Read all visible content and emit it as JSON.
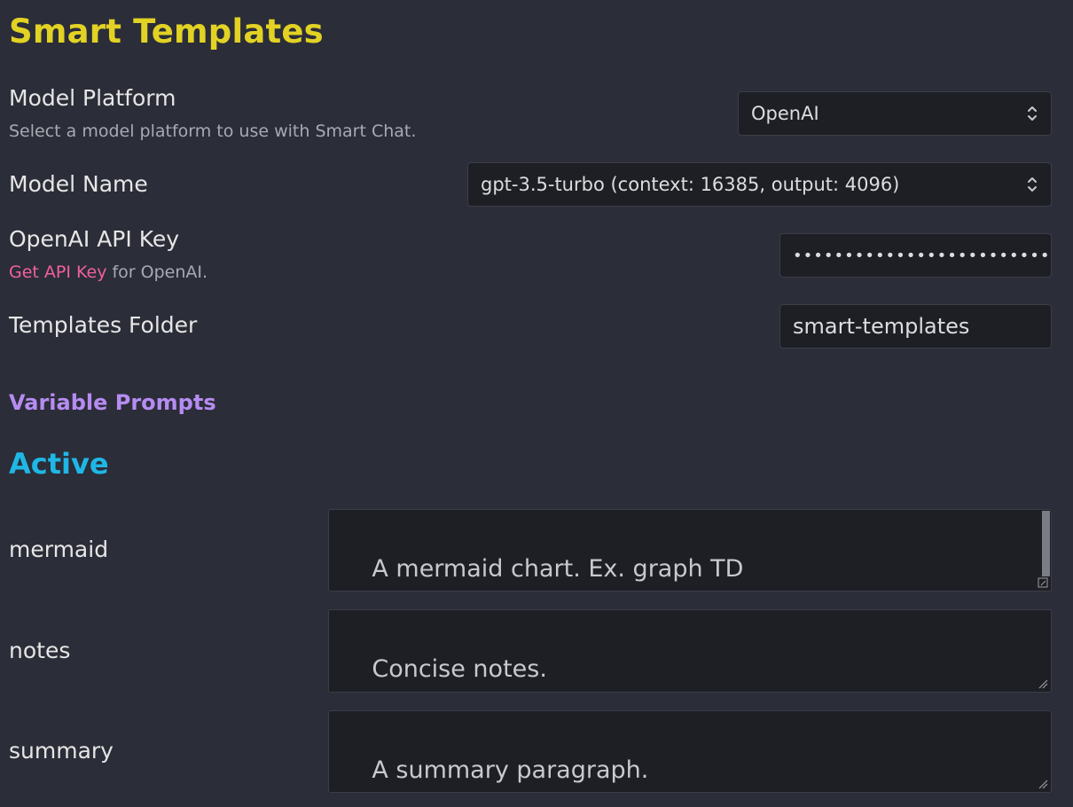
{
  "page": {
    "title": "Smart Templates"
  },
  "settings": {
    "model_platform": {
      "label": "Model Platform",
      "description": "Select a model platform to use with Smart Chat.",
      "value": "OpenAI"
    },
    "model_name": {
      "label": "Model Name",
      "value": "gpt-3.5-turbo (context: 16385, output: 4096)"
    },
    "api_key": {
      "label": "OpenAI API Key",
      "link_text": "Get API Key",
      "desc_suffix": " for OpenAI.",
      "value": "••••••••••••••••••••••••••••••••••"
    },
    "templates_folder": {
      "label": "Templates Folder",
      "value": "smart-templates"
    }
  },
  "variable_prompts": {
    "heading": "Variable Prompts",
    "active_heading": "Active",
    "items": [
      {
        "name": "mermaid",
        "prompt": "A mermaid chart. Ex. graph TD\nA --> B"
      },
      {
        "name": "notes",
        "prompt": "Concise notes."
      },
      {
        "name": "summary",
        "prompt": "A summary paragraph."
      }
    ]
  },
  "colors": {
    "title": "#e1d224",
    "subheading": "#b68cf2",
    "section": "#1fb7e5",
    "link": "#f0619b",
    "background": "#2b2d38",
    "field_background": "#1e1f25"
  },
  "icons": {
    "select_arrow": "chevron-up-down-icon",
    "textarea_resize": "resize-handle-icon"
  }
}
